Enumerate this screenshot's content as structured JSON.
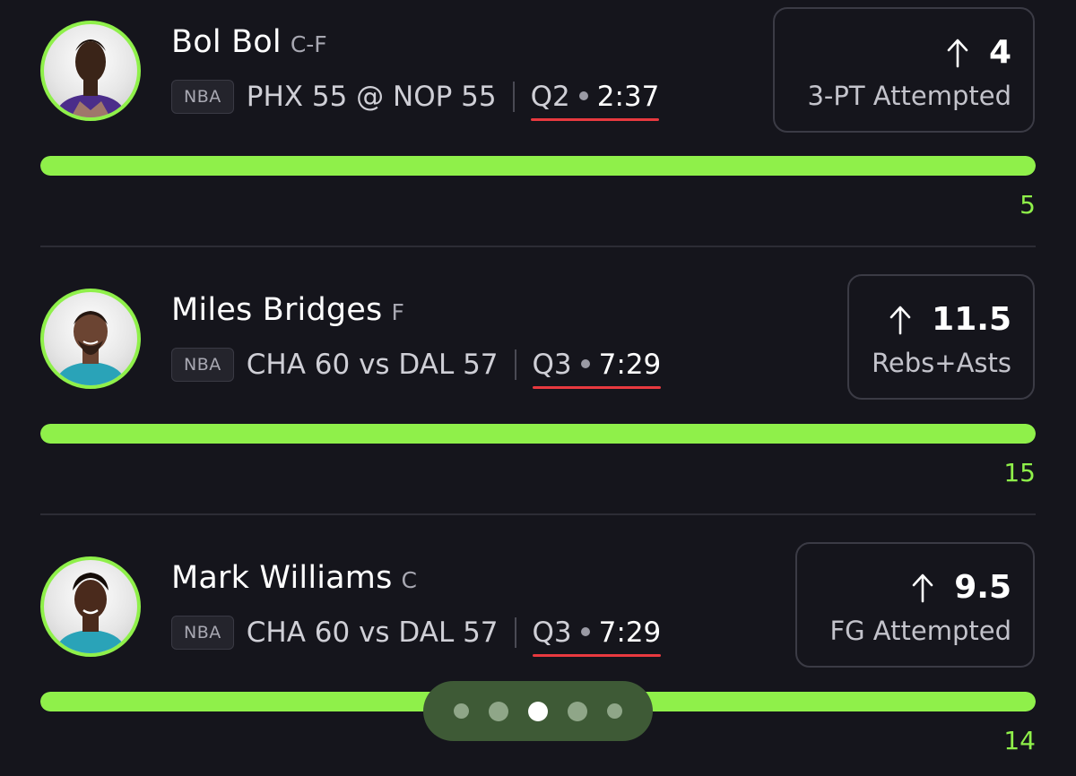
{
  "colors": {
    "background": "#15151c",
    "accent_green": "#8ff04a",
    "period_underline": "#e8393f"
  },
  "players": [
    {
      "name": "Bol Bol",
      "position": "C-F",
      "league": "NBA",
      "matchup": "PHX 55 @ NOP 55",
      "period": "Q2",
      "clock": "2:37",
      "direction_icon": "arrow-up-icon",
      "line": "4",
      "stat": "3-PT Attempted",
      "current": "5",
      "progress_fraction": 1.0,
      "jersey_color": "#4b2d8a"
    },
    {
      "name": "Miles Bridges",
      "position": "F",
      "league": "NBA",
      "matchup": "CHA 60 vs DAL 57",
      "period": "Q3",
      "clock": "7:29",
      "direction_icon": "arrow-up-icon",
      "line": "11.5",
      "stat": "Rebs+Asts",
      "current": "15",
      "progress_fraction": 1.0,
      "jersey_color": "#2aa3b8"
    },
    {
      "name": "Mark Williams",
      "position": "C",
      "league": "NBA",
      "matchup": "CHA 60 vs DAL 57",
      "period": "Q3",
      "clock": "7:29",
      "direction_icon": "arrow-up-icon",
      "line": "9.5",
      "stat": "FG Attempted",
      "current": "14",
      "progress_fraction": 1.0,
      "jersey_color": "#2aa3b8"
    }
  ],
  "pager": {
    "total": 5,
    "active_index": 2
  }
}
